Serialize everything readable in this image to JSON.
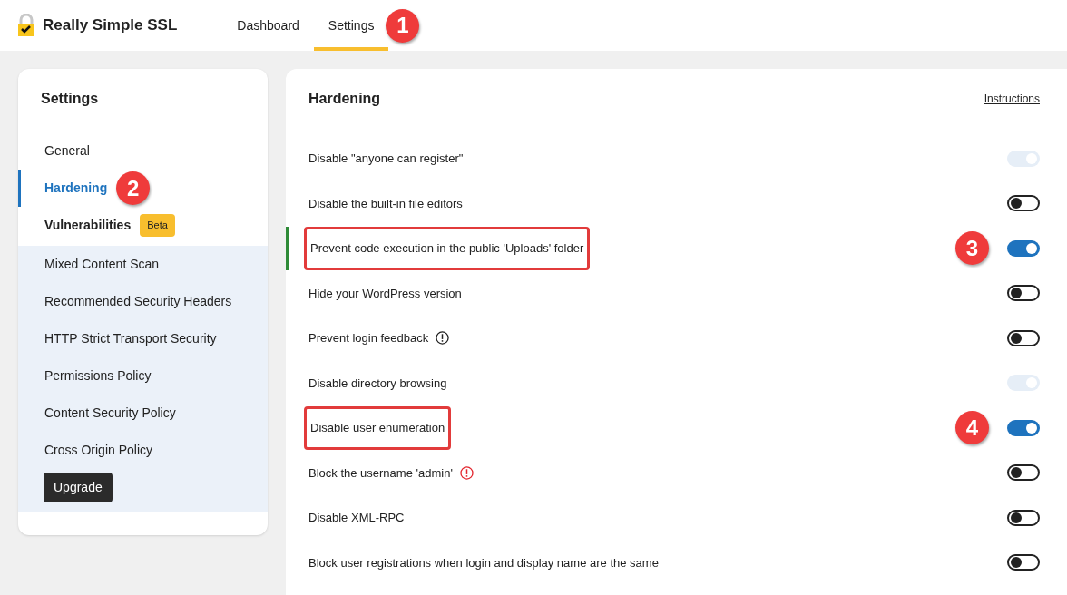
{
  "header": {
    "brand": "Really Simple SSL",
    "tabs": [
      {
        "label": "Dashboard",
        "selected": false
      },
      {
        "label": "Settings",
        "selected": true,
        "callout": "1"
      }
    ]
  },
  "sidebar": {
    "title": "Settings",
    "items": [
      {
        "label": "General",
        "selected": false,
        "kind": "basic"
      },
      {
        "label": "Hardening",
        "selected": true,
        "kind": "basic",
        "callout": "2"
      },
      {
        "label": "Vulnerabilities",
        "selected": false,
        "kind": "basic",
        "badge": "Beta"
      },
      {
        "label": "Mixed Content Scan",
        "selected": false,
        "kind": "pro"
      },
      {
        "label": "Recommended Security Headers",
        "selected": false,
        "kind": "pro"
      },
      {
        "label": "HTTP Strict Transport Security",
        "selected": false,
        "kind": "pro"
      },
      {
        "label": "Permissions Policy",
        "selected": false,
        "kind": "pro"
      },
      {
        "label": "Content Security Policy",
        "selected": false,
        "kind": "pro"
      },
      {
        "label": "Cross Origin Policy",
        "selected": false,
        "kind": "pro"
      }
    ],
    "upgrade": "Upgrade"
  },
  "panel": {
    "title": "Hardening",
    "link": "Instructions",
    "rows": [
      {
        "label": "Disable \"anyone can register\"",
        "kind": "plain",
        "on": true,
        "disabled": true,
        "highlighted": false,
        "outlined": false
      },
      {
        "label": "Disable the built-in file editors",
        "kind": "plain",
        "on": false,
        "disabled": false,
        "highlighted": false,
        "outlined": false
      },
      {
        "label": "Prevent code execution in the public 'Uploads' folder",
        "kind": "plain",
        "on": true,
        "disabled": false,
        "highlighted": true,
        "outlined": true,
        "callout": "3"
      },
      {
        "label": "Hide your WordPress version",
        "kind": "plain",
        "on": false,
        "disabled": false,
        "highlighted": false,
        "outlined": false
      },
      {
        "label": "Prevent login feedback",
        "kind": "info",
        "on": false,
        "disabled": false,
        "highlighted": false,
        "outlined": false
      },
      {
        "label": "Disable directory browsing",
        "kind": "plain",
        "on": true,
        "disabled": true,
        "highlighted": false,
        "outlined": false
      },
      {
        "label": "Disable user enumeration",
        "kind": "plain",
        "on": true,
        "disabled": false,
        "highlighted": false,
        "outlined": true,
        "callout": "4"
      },
      {
        "label": "Block the username 'admin'",
        "kind": "alert",
        "on": false,
        "disabled": false,
        "highlighted": false,
        "outlined": false
      },
      {
        "label": "Disable XML-RPC",
        "kind": "plain",
        "on": false,
        "disabled": false,
        "highlighted": false,
        "outlined": false
      },
      {
        "label": "Block user registrations when login and display name are the same",
        "kind": "plain",
        "on": false,
        "disabled": false,
        "highlighted": false,
        "outlined": false
      }
    ]
  }
}
